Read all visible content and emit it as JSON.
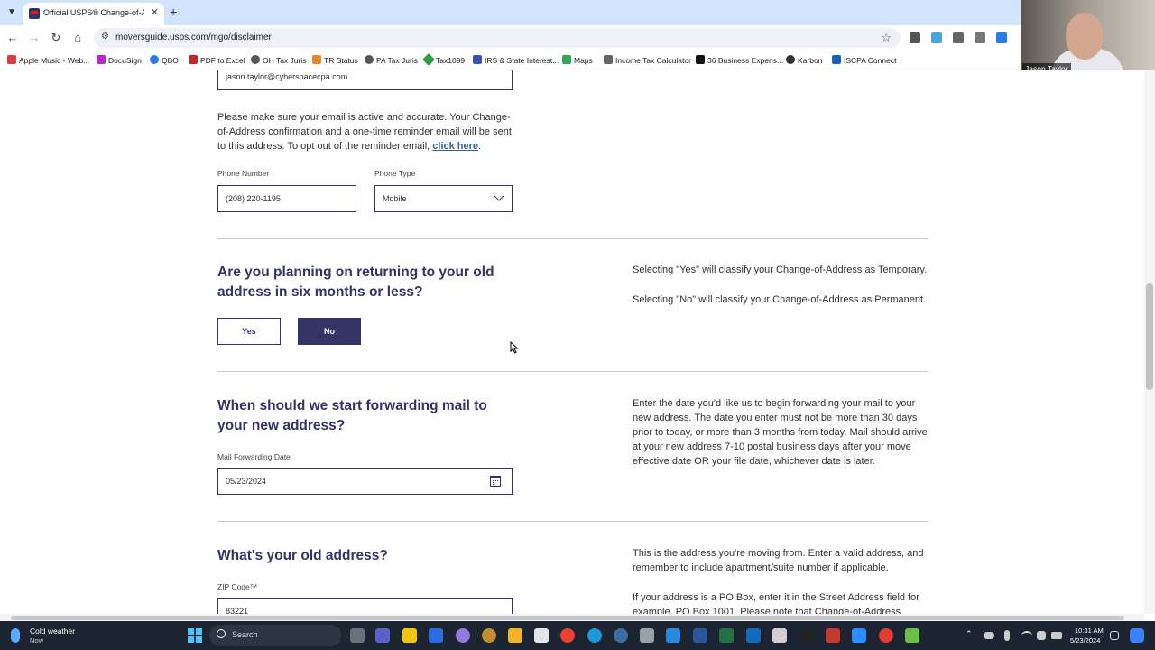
{
  "browser": {
    "tab_title": "Official USPS® Change-of-Ad",
    "url": "moversguide.usps.com/mgo/disclaimer",
    "bookmarks": [
      {
        "label": "Apple Music - Web...",
        "color": "#e5383b"
      },
      {
        "label": "DocuSign",
        "color": "#c026d3"
      },
      {
        "label": "QBO",
        "color": "#2c7be5"
      },
      {
        "label": "PDF to Excel",
        "color": "#c62828"
      },
      {
        "label": "OH Tax Juris",
        "color": "#555555"
      },
      {
        "label": "TR Status",
        "color": "#e08a2c"
      },
      {
        "label": "PA Tax Juris",
        "color": "#555555"
      },
      {
        "label": "Tax1099",
        "color": "#2e9e44"
      },
      {
        "label": "IRS & State Interest...",
        "color": "#3f51b5"
      },
      {
        "label": "Maps",
        "color": "#34a853"
      },
      {
        "label": "Income Tax Calculator",
        "color": "#666666"
      },
      {
        "label": "36 Business Expens...",
        "color": "#111111"
      },
      {
        "label": "Karbon",
        "color": "#333333"
      },
      {
        "label": "ISCPA Connect",
        "color": "#1565c0"
      }
    ]
  },
  "webcam": {
    "name": "Jason Taylor"
  },
  "form": {
    "email_value": "jason.taylor@cyberspacecpa.com",
    "email_notice": "Please make sure your email is active and accurate. Your Change-of-Address confirmation and a one-time reminder email will be sent to this address. To opt out of the reminder email,",
    "email_notice_link": "click here",
    "phone_label": "Phone Number",
    "phone_value": "(208) 220-1195",
    "phone_type_label": "Phone Type",
    "phone_type_value": "Mobile",
    "return_heading": "Are you planning on returning to your old address in six months or less?",
    "yes_label": "Yes",
    "no_label": "No",
    "return_note_1": "Selecting \"Yes\" will classify your Change-of-Address as Temporary.",
    "return_note_2": "Selecting \"No\" will classify your Change-of-Address as Permanent.",
    "forward_heading": "When should we start forwarding mail to your new address?",
    "forward_date_label": "Mail Forwarding Date",
    "forward_date_value": "05/23/2024",
    "forward_note": "Enter the date you'd like us to begin forwarding your mail to your new address. The date you enter must not be more than 30 days prior to today, or more than 3 months from today. Mail should arrive at your new address 7-10 postal business days after your move effective date OR your file date, whichever date is later.",
    "old_address_heading": "What's your old address?",
    "zip_label": "ZIP Code™",
    "zip_value": "83221",
    "old_address_note_1": "This is the address you're moving from. Enter a valid address, and remember to include apartment/suite number if applicable.",
    "old_address_note_2": "If your address is a PO Box, enter it in the Street Address field for example, PO Box 1001. Please note that Change-of-Address"
  },
  "taskbar": {
    "weather_title": "Cold weather",
    "weather_sub": "Now",
    "search_label": "Search",
    "time": "10:31 AM",
    "date": "5/23/2024"
  },
  "colors": {
    "usps_navy": "#333366",
    "link_blue": "#336699"
  }
}
